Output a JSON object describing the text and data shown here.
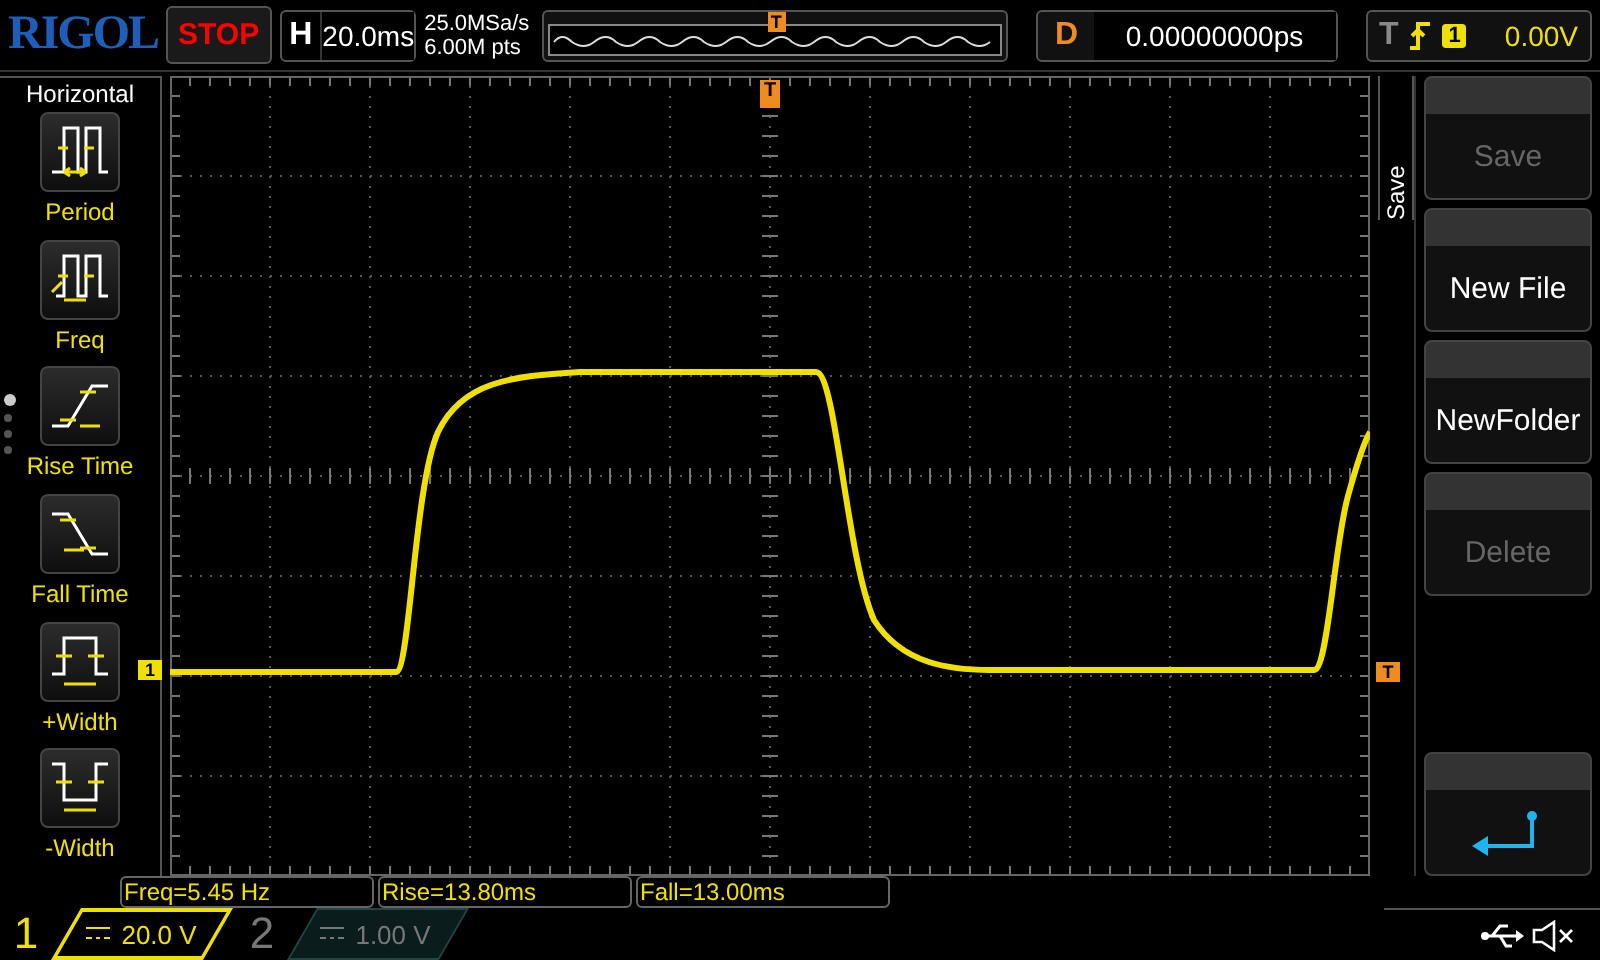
{
  "logo": "RIGOL",
  "run_state": "STOP",
  "timebase": {
    "label": "H",
    "value": "20.0ms"
  },
  "acquisition": {
    "sample_rate": "25.0MSa/s",
    "memory_depth": "6.00M pts"
  },
  "memory_bar": {
    "marker": "T"
  },
  "delay": {
    "label": "D",
    "value": "0.00000000ps"
  },
  "trigger": {
    "label": "T",
    "source": "1",
    "level": "0.00V"
  },
  "measure_menu": {
    "title": "Horizontal",
    "items": [
      {
        "label": "Period",
        "kind": "period"
      },
      {
        "label": "Freq",
        "kind": "freq"
      },
      {
        "label": "Rise Time",
        "kind": "rise"
      },
      {
        "label": "Fall Time",
        "kind": "fall"
      },
      {
        "label": "+Width",
        "kind": "pwidth"
      },
      {
        "label": "-Width",
        "kind": "nwidth"
      }
    ],
    "pages": [
      {
        "selected": true
      },
      {
        "selected": false
      },
      {
        "selected": false
      },
      {
        "selected": false
      }
    ]
  },
  "plot": {
    "channel_marker": "1",
    "trigger_position_marker": "T",
    "trigger_level_marker": "T"
  },
  "save_menu": {
    "title": "Save",
    "buttons": [
      {
        "kind": "text",
        "label": "Save",
        "disabled": true
      },
      {
        "kind": "text",
        "label": "New File",
        "disabled": false
      },
      {
        "kind": "text",
        "label": "NewFolder",
        "disabled": false
      },
      {
        "kind": "text",
        "label": "Delete",
        "disabled": true
      },
      {
        "kind": "back"
      }
    ]
  },
  "measurements": [
    "Freq=5.45 Hz",
    "Rise=13.80ms",
    "Fall=13.00ms"
  ],
  "channels": [
    {
      "number": "1",
      "scale": "20.0 V",
      "on": true
    },
    {
      "number": "2",
      "scale": "1.00 V",
      "on": false
    }
  ]
}
